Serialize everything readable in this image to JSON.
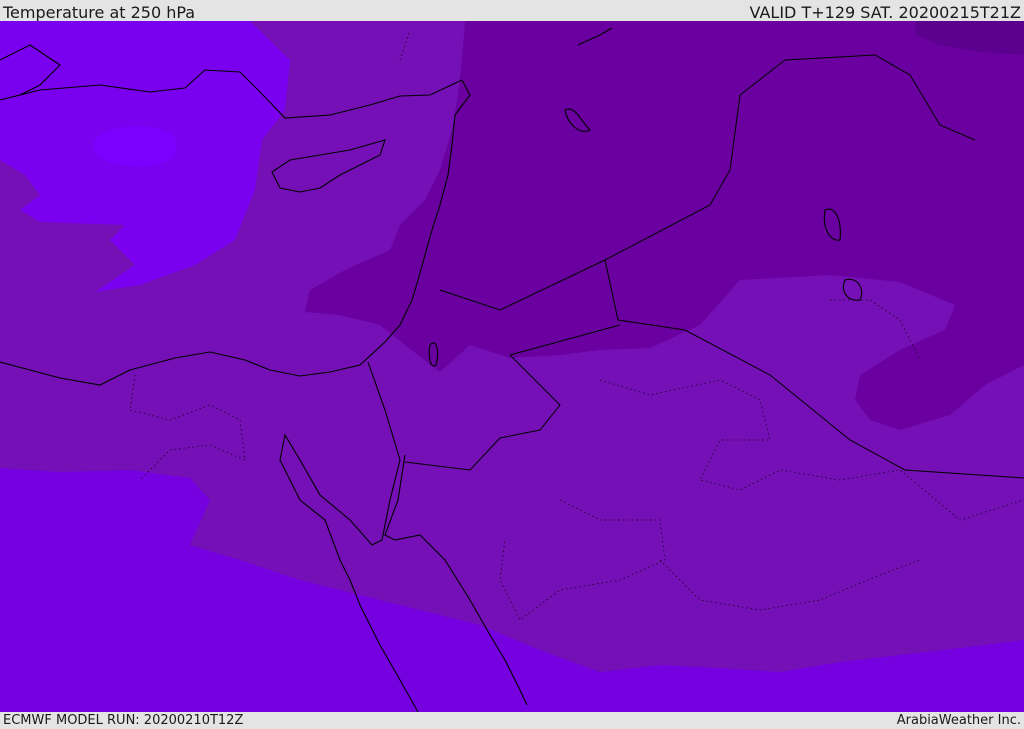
{
  "header": {
    "title": "Temperature at 250 hPa",
    "valid": "VALID T+129 SAT. 20200215T21Z"
  },
  "footer": {
    "model_run": "ECMWF MODEL RUN: 20200210T12Z",
    "credit": "ArabiaWeather Inc."
  },
  "colors": {
    "bar_bg": "#e4e4e4",
    "warmest": "#7500e0",
    "warm": "#7a00f0",
    "pocket": "#7b00ff",
    "mid": "#7410b5",
    "cool": "#6a009f",
    "coldest": "#5c0090",
    "coast": "#000000"
  },
  "legend_note": ""
}
